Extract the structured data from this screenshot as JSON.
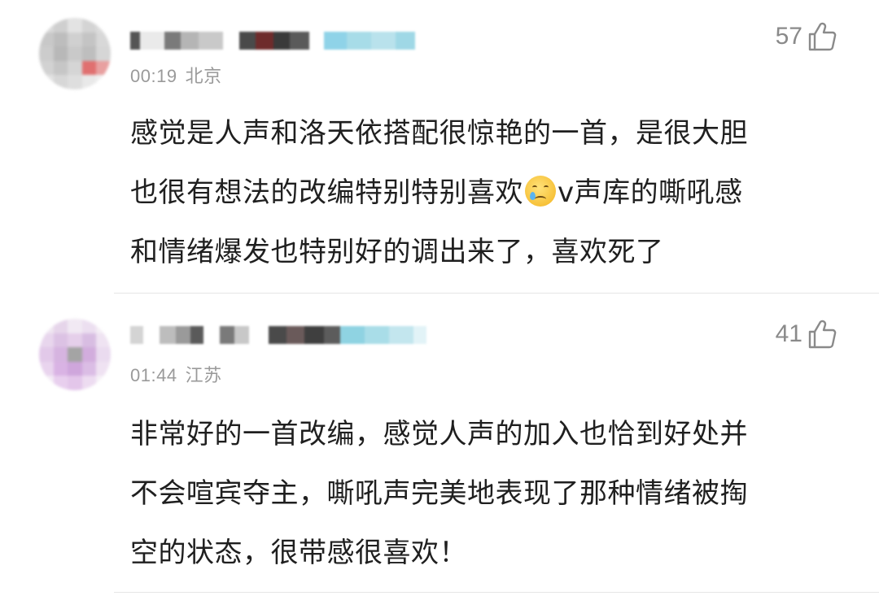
{
  "comments": [
    {
      "time": "00:19",
      "location": "北京",
      "likes": "57",
      "text_lines": [
        "感觉是人声和洛天依搭配很惊艳的一首，是很大胆",
        "也很有想法的改编特别特别喜欢",
        "和情绪爆发也特别好的调出来了，喜欢死了"
      ],
      "text_after_emoji": "v声库的嘶吼感",
      "emoji": "crying-face",
      "username_blurred": true
    },
    {
      "time": "01:44",
      "location": "江苏",
      "likes": "41",
      "text_lines": [
        "非常好的一首改编，感觉人声的加入也恰到好处并",
        "不会喧宾夺主，嘶吼声完美地表现了那种情绪被掏",
        "空的状态，很带感很喜欢！"
      ],
      "username_blurred": true
    }
  ],
  "icons": {
    "like": "thumbs-up-icon"
  },
  "colors": {
    "meta": "#9a9a9a",
    "likes": "#8a8a8a",
    "text": "#1f1f1f",
    "divider": "#e6e6e6"
  }
}
